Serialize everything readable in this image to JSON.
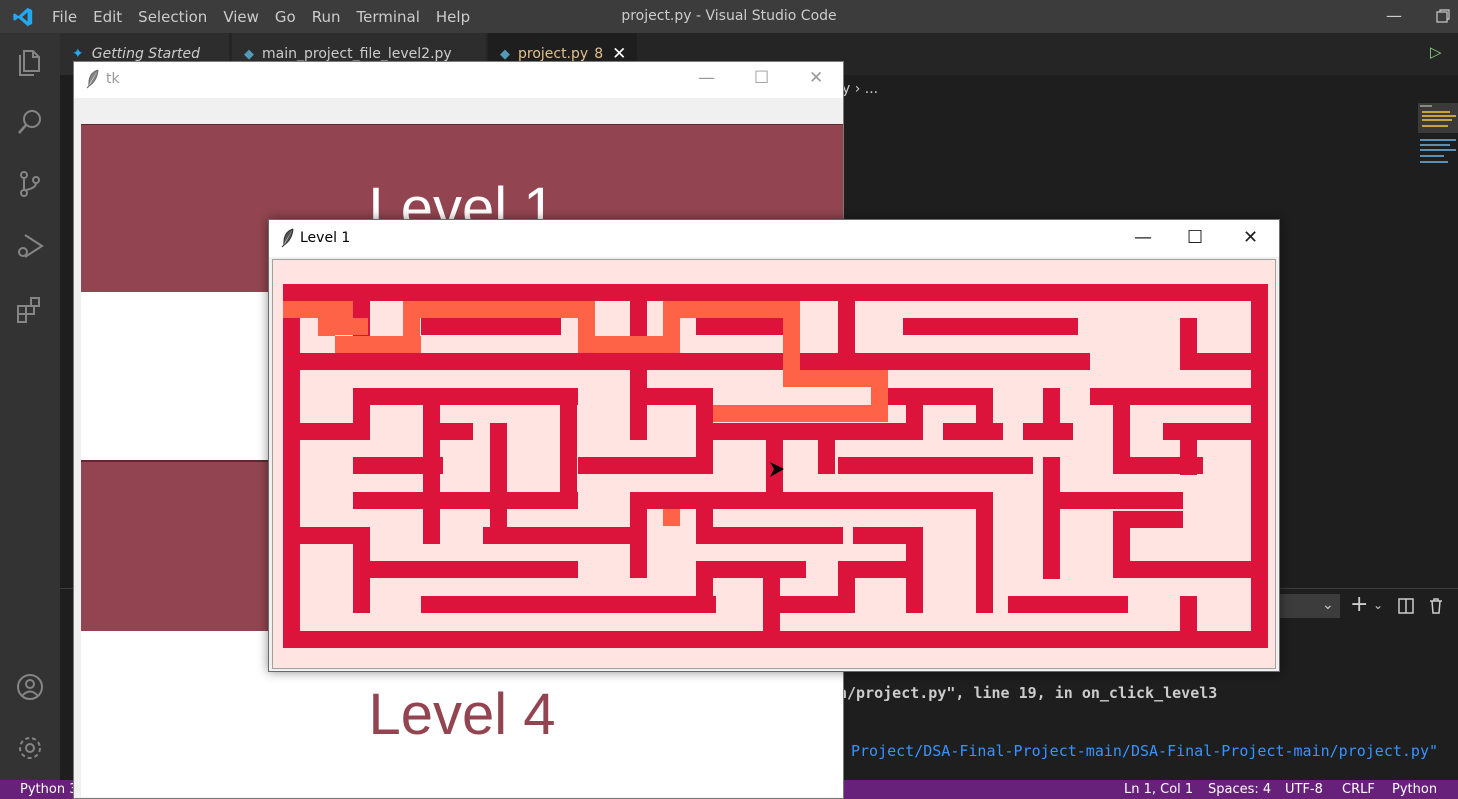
{
  "vscode": {
    "menu": [
      "File",
      "Edit",
      "Selection",
      "View",
      "Go",
      "Run",
      "Terminal",
      "Help"
    ],
    "window_title": "project.py - Visual Studio Code",
    "tabs": [
      {
        "label": "Getting Started"
      },
      {
        "label": "main_project_file_level2.py"
      },
      {
        "label": "project.py",
        "badge": "8"
      }
    ],
    "breadcrumb_tail": "y › ...",
    "terminal": {
      "line1": "n/project.py\", line 19, in on_click_level3",
      "line2": "Project/DSA-Final-Project-main/DSA-Final-Project-main/project.py\""
    },
    "status": {
      "left": "Python 3",
      "position": "Ln 1, Col 1",
      "spaces": "Spaces: 4",
      "encoding": "UTF-8",
      "eol": "CRLF",
      "language": "Python"
    },
    "colors": {
      "statusbar": "#68217a",
      "accent": "#3794ff"
    }
  },
  "tk_window": {
    "title": "tk",
    "levels": [
      "Level 1",
      "Level 4"
    ],
    "colors": {
      "button": "#924550",
      "text_light": "#ffffff",
      "text_dark": "#924550"
    }
  },
  "level_window": {
    "title": "Level 1",
    "colors": {
      "background": "#ffe4e1",
      "wall": "#dc143c",
      "path": "#ff6347",
      "agent": "#000000"
    },
    "icons": {
      "agent": "arrow-cursor-icon"
    }
  }
}
